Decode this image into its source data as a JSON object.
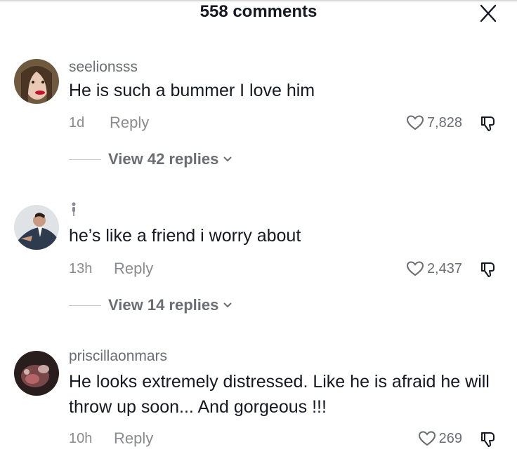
{
  "header": {
    "title": "558 comments"
  },
  "comments": [
    {
      "username": "seelionsss",
      "text": "He is such a bummer I love him",
      "time": "1d",
      "reply_label": "Reply",
      "likes": "7,828",
      "view_replies": "View 42 replies"
    },
    {
      "username_icon": "person-glyph-icon",
      "text": "he’s like a friend i worry about",
      "time": "13h",
      "reply_label": "Reply",
      "likes": "2,437",
      "view_replies": "View 14 replies"
    },
    {
      "username": "priscillaonmars",
      "text": "He looks extremely distressed. Like he is afraid he will throw up soon... And gorgeous !!!",
      "time": "10h",
      "reply_label": "Reply",
      "likes": "269"
    }
  ],
  "icons": [
    "close-icon",
    "heart-icon",
    "dislike-icon",
    "chevron-down-icon"
  ]
}
